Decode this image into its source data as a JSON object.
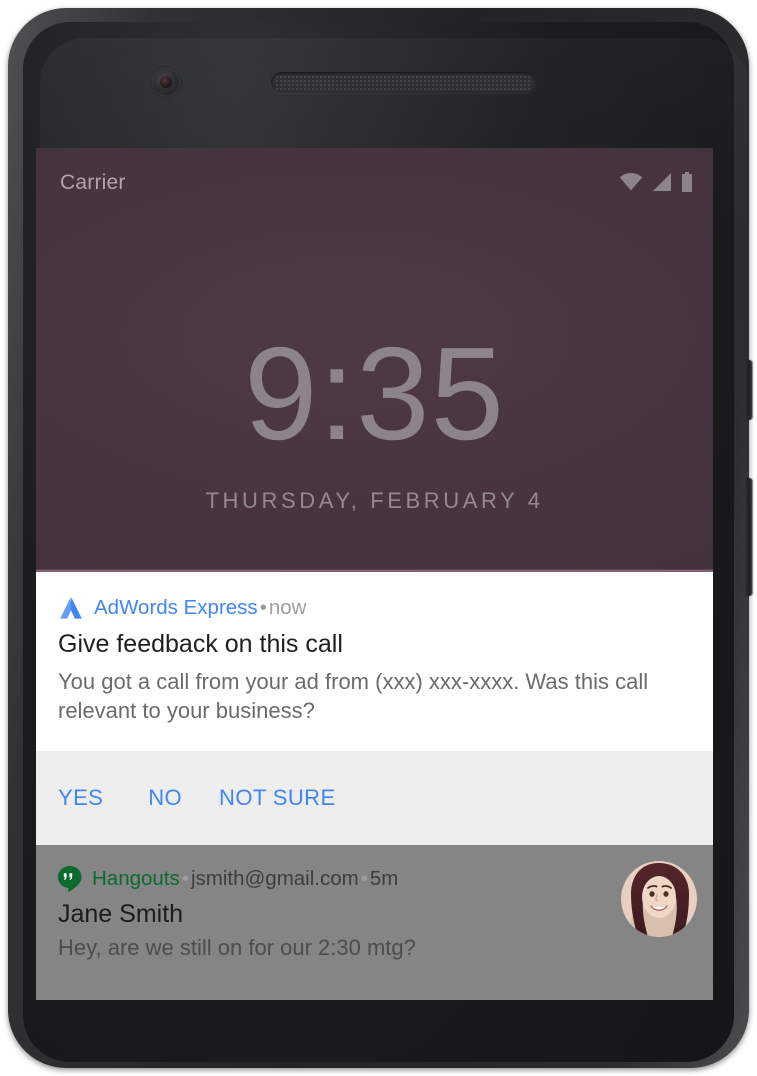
{
  "device": {
    "name": "android-phone",
    "camera_icon": "front-camera-icon",
    "earpiece_icon": "earpiece-speaker-icon",
    "power_button": "power-button",
    "volume_button": "volume-button"
  },
  "colors": {
    "wallpaper": "#473440",
    "accent_blue": "#4285f4",
    "hangouts_green": "#0b6b2e",
    "action_bar": "#eeeeee",
    "dimmed_notification": "#858585",
    "clock_text": "#8d8489"
  },
  "statusbar": {
    "carrier": "Carrier",
    "icons": [
      {
        "name": "wifi-icon",
        "label": "Wi-Fi"
      },
      {
        "name": "cellular-signal-icon",
        "label": "Signal"
      },
      {
        "name": "battery-icon",
        "label": "Battery"
      }
    ]
  },
  "lockscreen": {
    "clock": "9:35",
    "date": "THURSDAY, FEBRUARY 4"
  },
  "notifications": [
    {
      "id": "adwords-express",
      "app_icon": "adwords-express-icon",
      "app_name": "AdWords Express",
      "separator": "•",
      "time": "now",
      "title": "Give feedback on this call",
      "text": "You got a call from your ad from (xxx) xxx-xxxx. Was this call relevant to your business?",
      "actions": [
        {
          "name": "yes",
          "label": "YES"
        },
        {
          "name": "no",
          "label": "NO"
        },
        {
          "name": "not-sure",
          "label": "NOT SURE"
        }
      ]
    },
    {
      "id": "hangouts",
      "app_icon": "hangouts-icon",
      "app_name": "Hangouts",
      "separator": "•",
      "account": "jsmith@gmail.com",
      "time": "5m",
      "sender": "Jane Smith",
      "message": "Hey, are we still on for our 2:30 mtg?",
      "avatar": "contact-avatar"
    }
  ]
}
